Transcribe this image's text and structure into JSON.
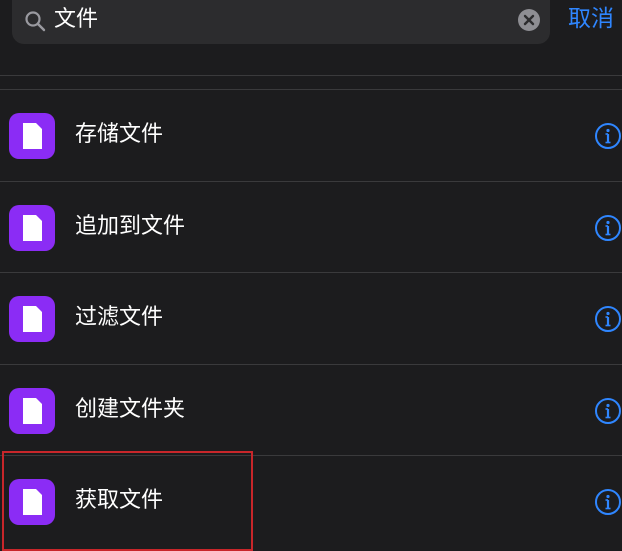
{
  "search": {
    "value": "文件",
    "cancel_label": "取消"
  },
  "actions": [
    {
      "label": "存储文件",
      "icon": "document-icon"
    },
    {
      "label": "追加到文件",
      "icon": "document-icon"
    },
    {
      "label": "过滤文件",
      "icon": "document-icon"
    },
    {
      "label": "创建文件夹",
      "icon": "document-icon"
    },
    {
      "label": "获取文件",
      "icon": "document-icon"
    }
  ],
  "colors": {
    "background": "#1c1c1e",
    "accent": "#2f86ff",
    "icon_bg": "#8b2cf5",
    "highlight": "#c8262a"
  }
}
